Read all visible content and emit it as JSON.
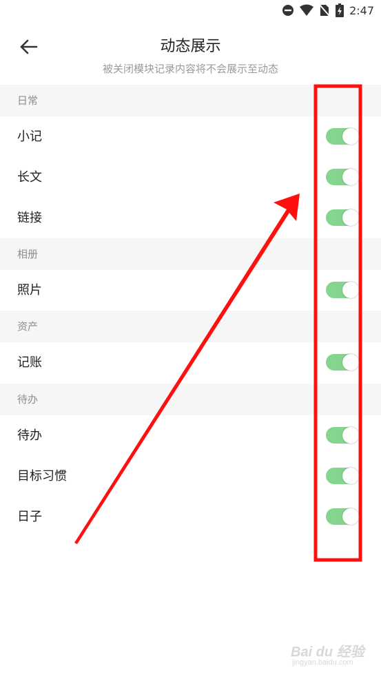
{
  "status_bar": {
    "time": "2:47",
    "icons": [
      "do-not-disturb-icon",
      "wifi-icon",
      "no-sim-icon",
      "battery-charging-icon"
    ]
  },
  "header": {
    "title": "动态展示",
    "subtitle": "被关闭模块记录内容将不会展示至动态",
    "back_icon": "arrow-left-icon"
  },
  "sections": [
    {
      "title": "日常",
      "items": [
        {
          "label": "小记",
          "enabled": true
        },
        {
          "label": "长文",
          "enabled": true
        },
        {
          "label": "链接",
          "enabled": true
        }
      ]
    },
    {
      "title": "相册",
      "items": [
        {
          "label": "照片",
          "enabled": true
        }
      ]
    },
    {
      "title": "资产",
      "items": [
        {
          "label": "记账",
          "enabled": true
        }
      ]
    },
    {
      "title": "待办",
      "items": [
        {
          "label": "待办",
          "enabled": true
        },
        {
          "label": "目标习惯",
          "enabled": true
        },
        {
          "label": "日子",
          "enabled": true
        }
      ]
    }
  ],
  "colors": {
    "toggle_on": "#86d58e",
    "section_bg": "#f6f6f6",
    "annotation": "#ff1010"
  },
  "watermark": {
    "logo": "Bai du 经验",
    "url": "jingyan.baidu.com"
  }
}
